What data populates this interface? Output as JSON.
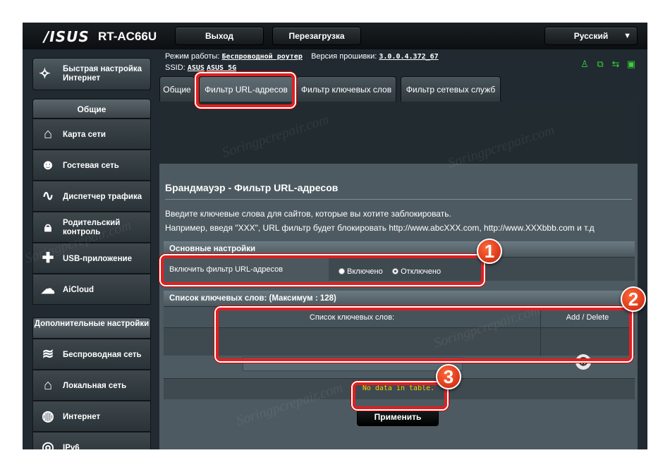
{
  "header": {
    "logo": "/ISUS",
    "model": "RT-AC66U",
    "logout_label": "Выход",
    "reboot_label": "Перезагрузка",
    "language": "Русский"
  },
  "info": {
    "mode_label": "Режим работы:",
    "mode_value": "Беспроводной роутер",
    "firmware_label": "Версия прошивки:",
    "firmware_value": "3.0.0.4.372_67",
    "ssid_label": "SSID:",
    "ssid_1": "ASUS",
    "ssid_2": "ASUS_5G"
  },
  "sidebar": {
    "quick_setup": "Быстрая настройка Интернет",
    "general_header": "Общие",
    "general_items": [
      {
        "label": "Карта сети",
        "icon": "network-map-icon"
      },
      {
        "label": "Гостевая сеть",
        "icon": "guest-network-icon"
      },
      {
        "label": "Диспетчер трафика",
        "icon": "traffic-manager-icon"
      },
      {
        "label": "Родительский контроль",
        "icon": "parental-control-icon"
      },
      {
        "label": "USB-приложение",
        "icon": "usb-app-icon"
      },
      {
        "label": "AiCloud",
        "icon": "aicloud-icon"
      }
    ],
    "advanced_header": "Дополнительные настройки",
    "advanced_items": [
      {
        "label": "Беспроводная сеть",
        "icon": "wireless-icon"
      },
      {
        "label": "Локальная сеть",
        "icon": "lan-icon"
      },
      {
        "label": "Интернет",
        "icon": "internet-icon"
      },
      {
        "label": "IPv6",
        "icon": "ipv6-icon"
      }
    ]
  },
  "tabs": [
    {
      "label": "Общие",
      "active": false
    },
    {
      "label": "Фильтр URL-адресов",
      "active": true
    },
    {
      "label": "Фильтр ключевых слов",
      "active": false
    },
    {
      "label": "Фильтр сетевых служб",
      "active": false
    }
  ],
  "main": {
    "title": "Брандмауэр - Фильтр URL-адресов",
    "desc_1": "Введите ключевые слова для сайтов, которые вы хотите заблокировать.",
    "desc_2": "Например, введя \"XXX\", URL фильтр будет блокировать http://www.abcXXX.com, http://www.XXXbbb.com и т.д",
    "basic_header": "Основные настройки",
    "enable_label": "Включить фильтр URL-адресов",
    "option_on": "Включено",
    "option_off": "Отключено",
    "selected_option": "Отключено",
    "list_header": "Список ключевых слов: (Максимум : 128)",
    "col_keywords": "Список ключевых слов:",
    "col_add_delete": "Add / Delete",
    "keyword_value": "",
    "empty_text": "No data in table.",
    "apply_label": "Применить"
  },
  "annotations": [
    "1",
    "2",
    "3"
  ],
  "watermark": "Soringpcrepair.com",
  "colors": {
    "annotation_red": "#e02020",
    "status_green": "#3cd13c",
    "no_data_yellow": "#ffcc00"
  }
}
